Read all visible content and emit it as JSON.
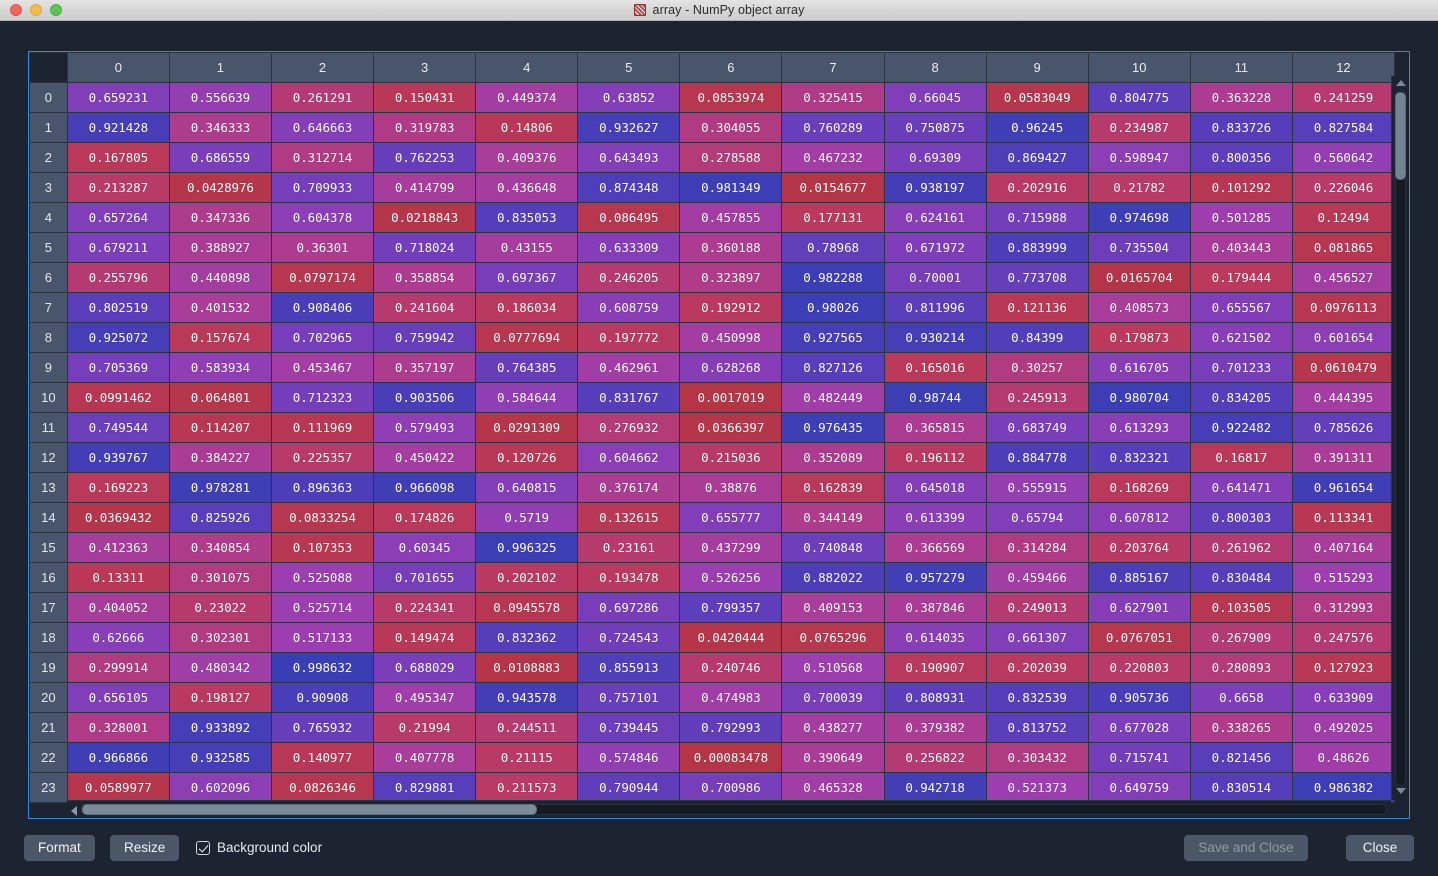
{
  "window": {
    "title": "array - NumPy object array",
    "icon": "numpy-array-icon",
    "traffic_lights": {
      "close_label": "close",
      "minimize_label": "minimize",
      "maximize_label": "maximize"
    }
  },
  "colors": {
    "app_background": "#1b2430",
    "table_border": "#2f88d8",
    "header_background": "#49556a",
    "header_text": "#e9edf3",
    "cell_text": "#ffffff",
    "grid_line": "#2a3342",
    "button_background": "#4b5769",
    "colormap_low": "#b83a4b",
    "colormap_mid": "#a23fb0",
    "colormap_high": "#3c3fb0"
  },
  "table": {
    "column_headers": [
      "0",
      "1",
      "2",
      "3",
      "4",
      "5",
      "6",
      "7",
      "8",
      "9",
      "10",
      "11",
      "12"
    ],
    "row_headers": [
      "0",
      "1",
      "2",
      "3",
      "4",
      "5",
      "6",
      "7",
      "8",
      "9",
      "10",
      "11",
      "12",
      "13",
      "14",
      "15",
      "16",
      "17",
      "18",
      "19",
      "20",
      "21",
      "22",
      "23"
    ],
    "rows": [
      [
        "0.659231",
        "0.556639",
        "0.261291",
        "0.150431",
        "0.449374",
        "0.63852",
        "0.0853974",
        "0.325415",
        "0.66045",
        "0.0583049",
        "0.804775",
        "0.363228",
        "0.241259"
      ],
      [
        "0.921428",
        "0.346333",
        "0.646663",
        "0.319783",
        "0.14806",
        "0.932627",
        "0.304055",
        "0.760289",
        "0.750875",
        "0.96245",
        "0.234987",
        "0.833726",
        "0.827584"
      ],
      [
        "0.167805",
        "0.686559",
        "0.312714",
        "0.762253",
        "0.409376",
        "0.643493",
        "0.278588",
        "0.467232",
        "0.69309",
        "0.869427",
        "0.598947",
        "0.800356",
        "0.560642"
      ],
      [
        "0.213287",
        "0.0428976",
        "0.709933",
        "0.414799",
        "0.436648",
        "0.874348",
        "0.981349",
        "0.0154677",
        "0.938197",
        "0.202916",
        "0.21782",
        "0.101292",
        "0.226046"
      ],
      [
        "0.657264",
        "0.347336",
        "0.604378",
        "0.0218843",
        "0.835053",
        "0.086495",
        "0.457855",
        "0.177131",
        "0.624161",
        "0.715988",
        "0.974698",
        "0.501285",
        "0.12494"
      ],
      [
        "0.679211",
        "0.388927",
        "0.36301",
        "0.718024",
        "0.43155",
        "0.633309",
        "0.360188",
        "0.78968",
        "0.671972",
        "0.883999",
        "0.735504",
        "0.403443",
        "0.081865"
      ],
      [
        "0.255796",
        "0.440898",
        "0.0797174",
        "0.358854",
        "0.697367",
        "0.246205",
        "0.323897",
        "0.982288",
        "0.70001",
        "0.773708",
        "0.0165704",
        "0.179444",
        "0.456527"
      ],
      [
        "0.802519",
        "0.401532",
        "0.908406",
        "0.241604",
        "0.186034",
        "0.608759",
        "0.192912",
        "0.98026",
        "0.811996",
        "0.121136",
        "0.408573",
        "0.655567",
        "0.0976113"
      ],
      [
        "0.925072",
        "0.157674",
        "0.702965",
        "0.759942",
        "0.0777694",
        "0.197772",
        "0.450998",
        "0.927565",
        "0.930214",
        "0.84399",
        "0.179873",
        "0.621502",
        "0.601654"
      ],
      [
        "0.705369",
        "0.583934",
        "0.453467",
        "0.357197",
        "0.764385",
        "0.462961",
        "0.628268",
        "0.827126",
        "0.165016",
        "0.30257",
        "0.616705",
        "0.701233",
        "0.0610479"
      ],
      [
        "0.0991462",
        "0.064801",
        "0.712323",
        "0.903506",
        "0.584644",
        "0.831767",
        "0.0017019",
        "0.482449",
        "0.98744",
        "0.245913",
        "0.980704",
        "0.834205",
        "0.444395"
      ],
      [
        "0.749544",
        "0.114207",
        "0.111969",
        "0.579493",
        "0.0291309",
        "0.276932",
        "0.0366397",
        "0.976435",
        "0.365815",
        "0.683749",
        "0.613293",
        "0.922482",
        "0.785626"
      ],
      [
        "0.939767",
        "0.384227",
        "0.225357",
        "0.450422",
        "0.120726",
        "0.604662",
        "0.215036",
        "0.352089",
        "0.196112",
        "0.884778",
        "0.832321",
        "0.16817",
        "0.391311"
      ],
      [
        "0.169223",
        "0.978281",
        "0.896363",
        "0.966098",
        "0.640815",
        "0.376174",
        "0.38876",
        "0.162839",
        "0.645018",
        "0.555915",
        "0.168269",
        "0.641471",
        "0.961654"
      ],
      [
        "0.0369432",
        "0.825926",
        "0.0833254",
        "0.174826",
        "0.5719",
        "0.132615",
        "0.655777",
        "0.344149",
        "0.613399",
        "0.65794",
        "0.607812",
        "0.800303",
        "0.113341"
      ],
      [
        "0.412363",
        "0.340854",
        "0.107353",
        "0.60345",
        "0.996325",
        "0.23161",
        "0.437299",
        "0.740848",
        "0.366569",
        "0.314284",
        "0.203764",
        "0.261962",
        "0.407164"
      ],
      [
        "0.13311",
        "0.301075",
        "0.525088",
        "0.701655",
        "0.202102",
        "0.193478",
        "0.526256",
        "0.882022",
        "0.957279",
        "0.459466",
        "0.885167",
        "0.830484",
        "0.515293"
      ],
      [
        "0.404052",
        "0.23022",
        "0.525714",
        "0.224341",
        "0.0945578",
        "0.697286",
        "0.799357",
        "0.409153",
        "0.387846",
        "0.249013",
        "0.627901",
        "0.103505",
        "0.312993"
      ],
      [
        "0.62666",
        "0.302301",
        "0.517133",
        "0.149474",
        "0.832362",
        "0.724543",
        "0.0420444",
        "0.0765296",
        "0.614035",
        "0.661307",
        "0.0767051",
        "0.267909",
        "0.247576"
      ],
      [
        "0.299914",
        "0.480342",
        "0.998632",
        "0.688029",
        "0.0108883",
        "0.855913",
        "0.240746",
        "0.510568",
        "0.190907",
        "0.202039",
        "0.220803",
        "0.280893",
        "0.127923"
      ],
      [
        "0.656105",
        "0.198127",
        "0.90908",
        "0.495347",
        "0.943578",
        "0.757101",
        "0.474983",
        "0.700039",
        "0.808931",
        "0.832539",
        "0.905736",
        "0.6658",
        "0.633909"
      ],
      [
        "0.328001",
        "0.933892",
        "0.765932",
        "0.21994",
        "0.244511",
        "0.739445",
        "0.792993",
        "0.438277",
        "0.379382",
        "0.813752",
        "0.677028",
        "0.338265",
        "0.492025"
      ],
      [
        "0.966866",
        "0.932585",
        "0.140977",
        "0.407778",
        "0.21115",
        "0.574846",
        "0.00083478",
        "0.390649",
        "0.256822",
        "0.303432",
        "0.715741",
        "0.821456",
        "0.48626"
      ],
      [
        "0.0589977",
        "0.602096",
        "0.0826346",
        "0.829881",
        "0.211573",
        "0.790944",
        "0.700986",
        "0.465328",
        "0.942718",
        "0.521373",
        "0.649759",
        "0.830514",
        "0.986382"
      ]
    ]
  },
  "scrollbars": {
    "vertical": {
      "up_arrow": "scroll-up-arrow",
      "down_arrow": "scroll-down-arrow"
    },
    "horizontal": {
      "left_arrow": "scroll-left-arrow"
    }
  },
  "bottom_bar": {
    "format_label": "Format",
    "resize_label": "Resize",
    "background_color_label": "Background color",
    "background_color_checked": true,
    "save_and_close_label": "Save and Close",
    "save_and_close_enabled": false,
    "close_label": "Close"
  }
}
